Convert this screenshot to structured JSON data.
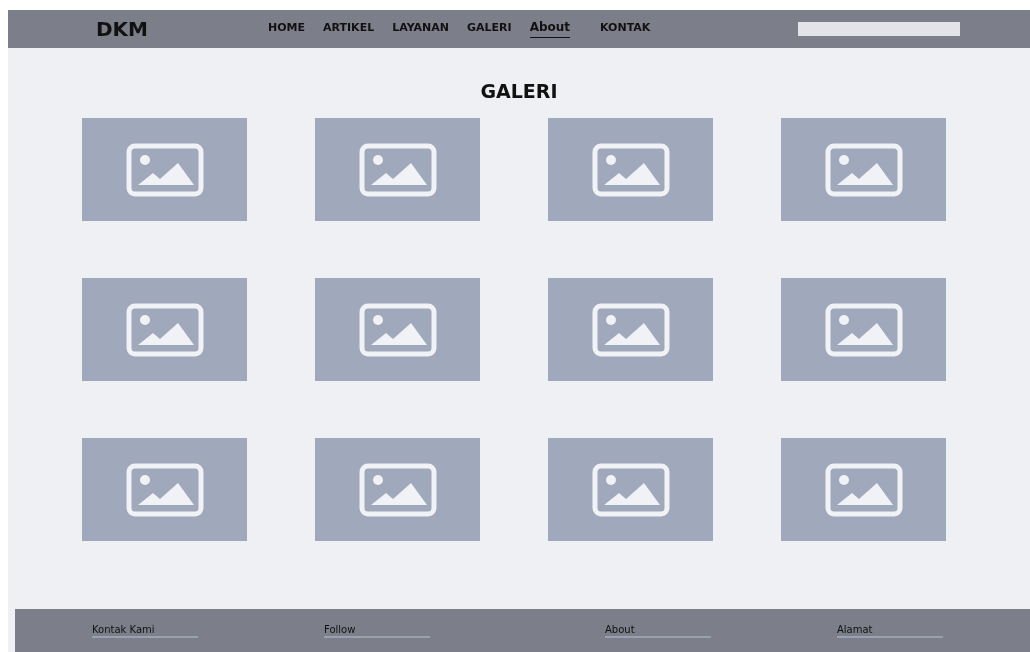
{
  "header": {
    "logo": "DKM",
    "nav": [
      {
        "label": "HOME",
        "selected": false
      },
      {
        "label": "ARTIKEL",
        "selected": false
      },
      {
        "label": "LAYANAN",
        "selected": false
      },
      {
        "label": "GALERI",
        "selected": false
      },
      {
        "label": "About",
        "selected": true
      },
      {
        "label": "KONTAK",
        "selected": false
      }
    ]
  },
  "gallery": {
    "title": "GALERI",
    "items": [
      {
        "kind": "placeholder"
      },
      {
        "kind": "placeholder"
      },
      {
        "kind": "placeholder"
      },
      {
        "kind": "placeholder"
      },
      {
        "kind": "placeholder"
      },
      {
        "kind": "placeholder"
      },
      {
        "kind": "placeholder"
      },
      {
        "kind": "placeholder"
      },
      {
        "kind": "placeholder"
      },
      {
        "kind": "placeholder"
      },
      {
        "kind": "placeholder"
      },
      {
        "kind": "placeholder"
      }
    ]
  },
  "footer": {
    "columns": [
      "Kontak Kami",
      "Follow",
      "About",
      "Alamat"
    ]
  }
}
